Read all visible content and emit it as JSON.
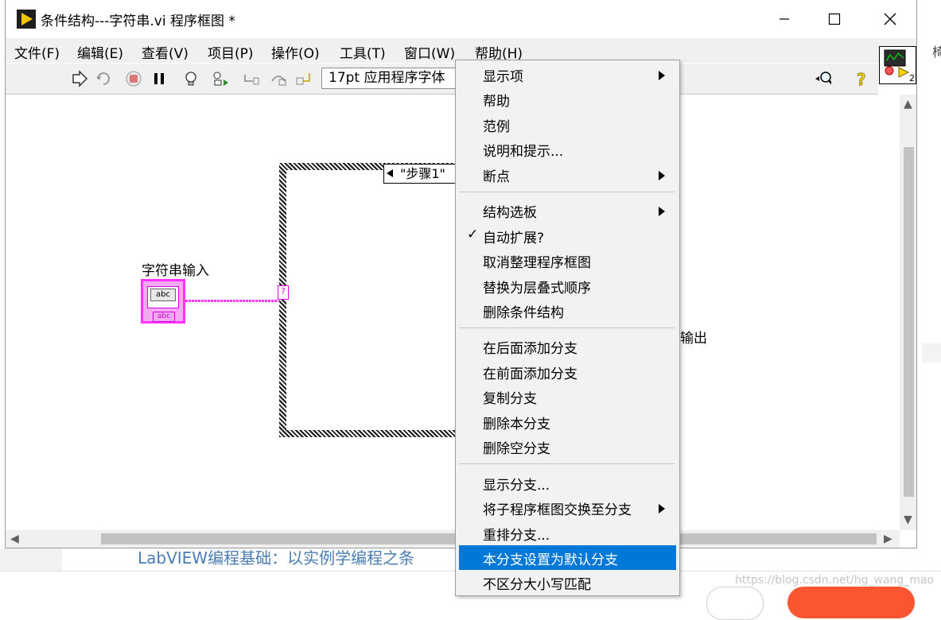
{
  "window": {
    "title": "条件结构---字符串.vi 程序框图 *"
  },
  "menubar": {
    "items": [
      "文件(F)",
      "编辑(E)",
      "查看(V)",
      "项目(P)",
      "操作(O)",
      "工具(T)",
      "窗口(W)",
      "帮助(H)"
    ]
  },
  "toolbar": {
    "font": "17pt 应用程序字体"
  },
  "diagram": {
    "case_selector": "\"步骤1\"",
    "terminal_glyph": "?",
    "string_control_label": "字符串输入",
    "string_control_text": "abc",
    "string_terminal_text": "abc",
    "output_label": "输出",
    "vi_icon_number": "2"
  },
  "context_menu": {
    "items": [
      {
        "label": "显示项",
        "submenu": true
      },
      {
        "label": "帮助"
      },
      {
        "label": "范例"
      },
      {
        "label": "说明和提示..."
      },
      {
        "label": "断点",
        "submenu": true
      },
      {
        "label": "结构选板",
        "submenu": true
      },
      {
        "label": "自动扩展?",
        "checked": true
      },
      {
        "label": "取消整理程序框图"
      },
      {
        "label": "替换为层叠式顺序"
      },
      {
        "label": "删除条件结构"
      },
      {
        "label": "在后面添加分支"
      },
      {
        "label": "在前面添加分支"
      },
      {
        "label": "复制分支"
      },
      {
        "label": "删除本分支"
      },
      {
        "label": "删除空分支"
      },
      {
        "label": "显示分支..."
      },
      {
        "label": "将子程序框图交换至分支",
        "submenu": true
      },
      {
        "label": "重排分支..."
      },
      {
        "label": "本分支设置为默认分支",
        "highlighted": true
      },
      {
        "label": "不区分大小写匹配"
      }
    ],
    "check_mark": "✓"
  },
  "background": {
    "article_title": "LabVIEW编程基础：以实例学编程之条",
    "watermark": "https://blog.csdn.net/hg_wang_mao",
    "right_char": "椅"
  },
  "colors": {
    "highlight": "#0078d7",
    "string_wire": "#ff33ff",
    "menu_bg": "#f2f2f2"
  }
}
